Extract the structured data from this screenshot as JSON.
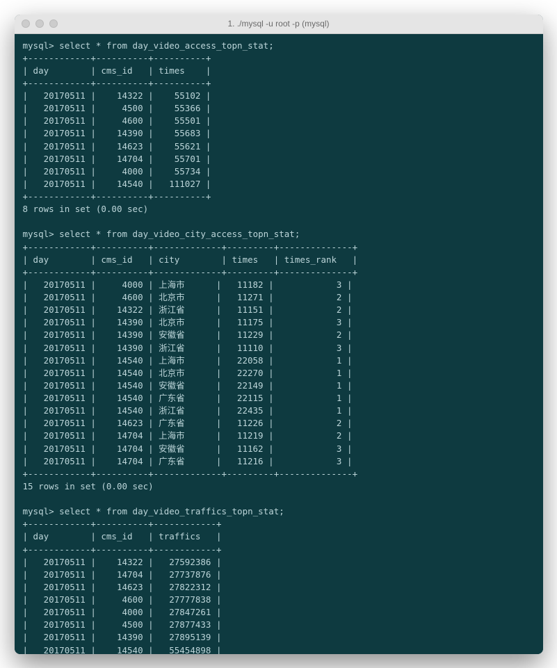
{
  "window": {
    "title": "1. ./mysql -u root -p (mysql)"
  },
  "prompt": "mysql>",
  "queries": {
    "q1": {
      "sql": "select * from day_video_access_topn_stat;",
      "columns": [
        "day",
        "cms_id",
        "times"
      ],
      "widths": [
        10,
        8,
        8
      ],
      "rows": [
        [
          "20170511",
          "14322",
          "55102"
        ],
        [
          "20170511",
          "4500",
          "55366"
        ],
        [
          "20170511",
          "4600",
          "55501"
        ],
        [
          "20170511",
          "14390",
          "55683"
        ],
        [
          "20170511",
          "14623",
          "55621"
        ],
        [
          "20170511",
          "14704",
          "55701"
        ],
        [
          "20170511",
          "4000",
          "55734"
        ],
        [
          "20170511",
          "14540",
          "111027"
        ]
      ],
      "footer": "8 rows in set (0.00 sec)"
    },
    "q2": {
      "sql": "select * from day_video_city_access_topn_stat;",
      "columns": [
        "day",
        "cms_id",
        "city",
        "times",
        "times_rank"
      ],
      "widths": [
        10,
        8,
        11,
        7,
        12
      ],
      "rows": [
        [
          "20170511",
          "4000",
          "上海市",
          "11182",
          "3"
        ],
        [
          "20170511",
          "4600",
          "北京市",
          "11271",
          "2"
        ],
        [
          "20170511",
          "14322",
          "浙江省",
          "11151",
          "2"
        ],
        [
          "20170511",
          "14390",
          "北京市",
          "11175",
          "3"
        ],
        [
          "20170511",
          "14390",
          "安徽省",
          "11229",
          "2"
        ],
        [
          "20170511",
          "14390",
          "浙江省",
          "11110",
          "3"
        ],
        [
          "20170511",
          "14540",
          "上海市",
          "22058",
          "1"
        ],
        [
          "20170511",
          "14540",
          "北京市",
          "22270",
          "1"
        ],
        [
          "20170511",
          "14540",
          "安徽省",
          "22149",
          "1"
        ],
        [
          "20170511",
          "14540",
          "广东省",
          "22115",
          "1"
        ],
        [
          "20170511",
          "14540",
          "浙江省",
          "22435",
          "1"
        ],
        [
          "20170511",
          "14623",
          "广东省",
          "11226",
          "2"
        ],
        [
          "20170511",
          "14704",
          "上海市",
          "11219",
          "2"
        ],
        [
          "20170511",
          "14704",
          "安徽省",
          "11162",
          "3"
        ],
        [
          "20170511",
          "14704",
          "广东省",
          "11216",
          "3"
        ]
      ],
      "footer": "15 rows in set (0.00 sec)"
    },
    "q3": {
      "sql": "select * from day_video_traffics_topn_stat;",
      "columns": [
        "day",
        "cms_id",
        "traffics"
      ],
      "widths": [
        10,
        8,
        10
      ],
      "rows": [
        [
          "20170511",
          "14322",
          "27592386"
        ],
        [
          "20170511",
          "14704",
          "27737876"
        ],
        [
          "20170511",
          "14623",
          "27822312"
        ],
        [
          "20170511",
          "4600",
          "27777838"
        ],
        [
          "20170511",
          "4000",
          "27847261"
        ],
        [
          "20170511",
          "4500",
          "27877433"
        ],
        [
          "20170511",
          "14390",
          "27895139"
        ],
        [
          "20170511",
          "14540",
          "55454898"
        ]
      ],
      "footer": ""
    }
  }
}
